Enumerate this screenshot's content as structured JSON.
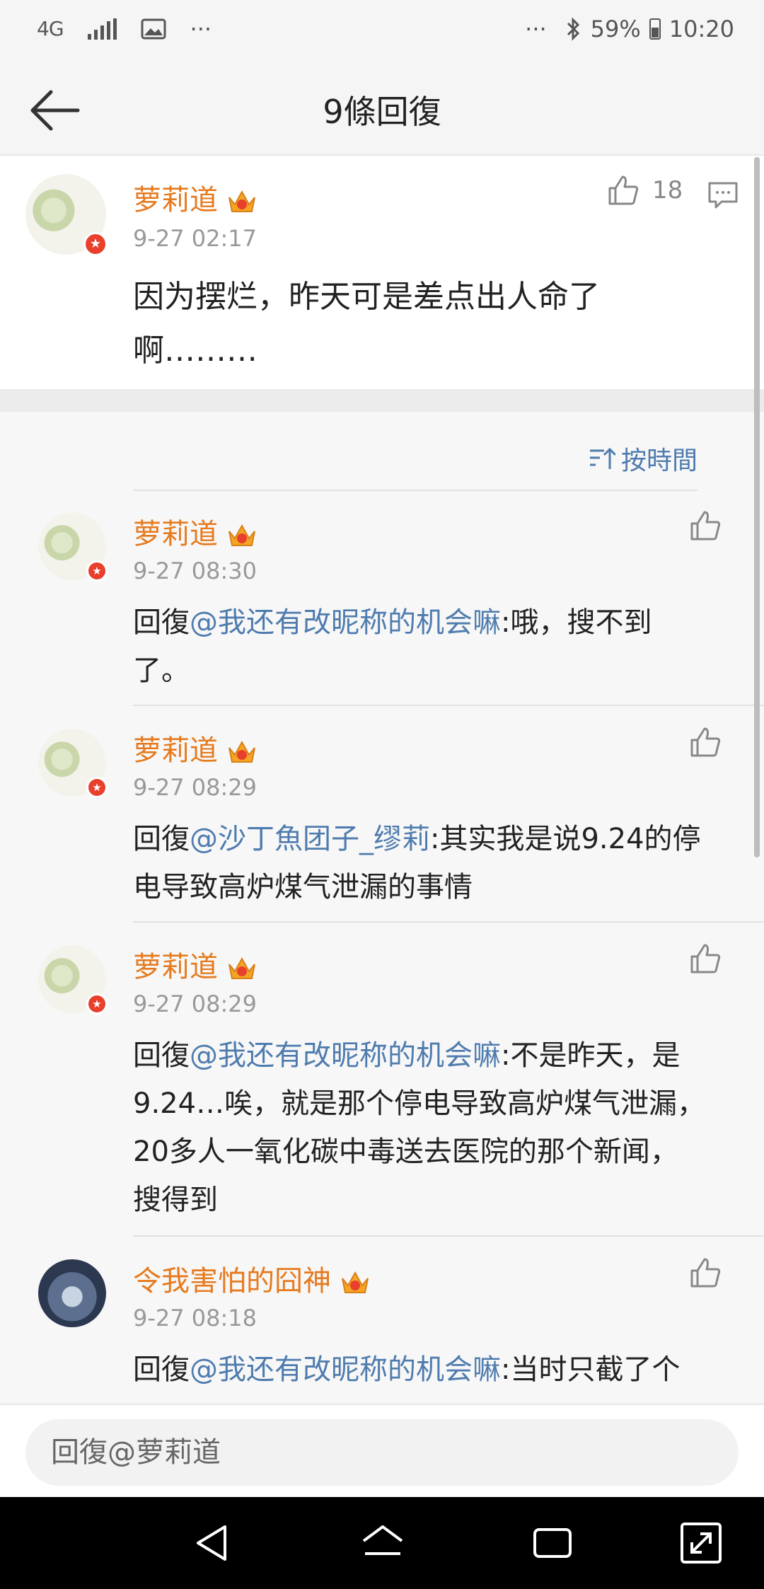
{
  "status_bar": {
    "network": "4G",
    "more": "···",
    "right_more": "···",
    "battery": "59%",
    "time": "10:20"
  },
  "header": {
    "title": "9條回復"
  },
  "main_post": {
    "username": "萝莉道",
    "time": "9-27 02:17",
    "text_line1": "因为摆烂，昨天可是差点出人命了",
    "text_line2": "啊………",
    "like_count": "18"
  },
  "sort_label": "按時間",
  "replies": [
    {
      "username": "萝莉道",
      "time": "9-27 08:30",
      "prefix": "回復",
      "mention": "@我还有改昵称的机会嘛",
      "lines": [
        ":哦，搜不到",
        "了。"
      ]
    },
    {
      "username": "萝莉道",
      "time": "9-27 08:29",
      "prefix": "回復",
      "mention": "@沙丁魚团子_缪莉",
      "lines": [
        ":其实我是说9.24的停",
        "电导致高炉煤气泄漏的事情"
      ]
    },
    {
      "username": "萝莉道",
      "time": "9-27 08:29",
      "prefix": "回復",
      "mention": "@我还有改昵称的机会嘛",
      "lines": [
        ":不是昨天，是",
        "9.24…唉，就是那个停电导致高炉煤气泄漏，",
        "20多人一氧化碳中毒送去医院的那个新闻，",
        "搜得到"
      ]
    },
    {
      "username": "令我害怕的囧神",
      "time": "9-27 08:18",
      "prefix": "回復",
      "mention": "@我还有改昵称的机会嘛",
      "lines": [
        ":当时只截了个"
      ]
    }
  ],
  "input": {
    "placeholder": "回復@萝莉道"
  },
  "colors": {
    "username": "#e67a1e",
    "mention": "#4f7cae",
    "badge": "#e8402c"
  }
}
